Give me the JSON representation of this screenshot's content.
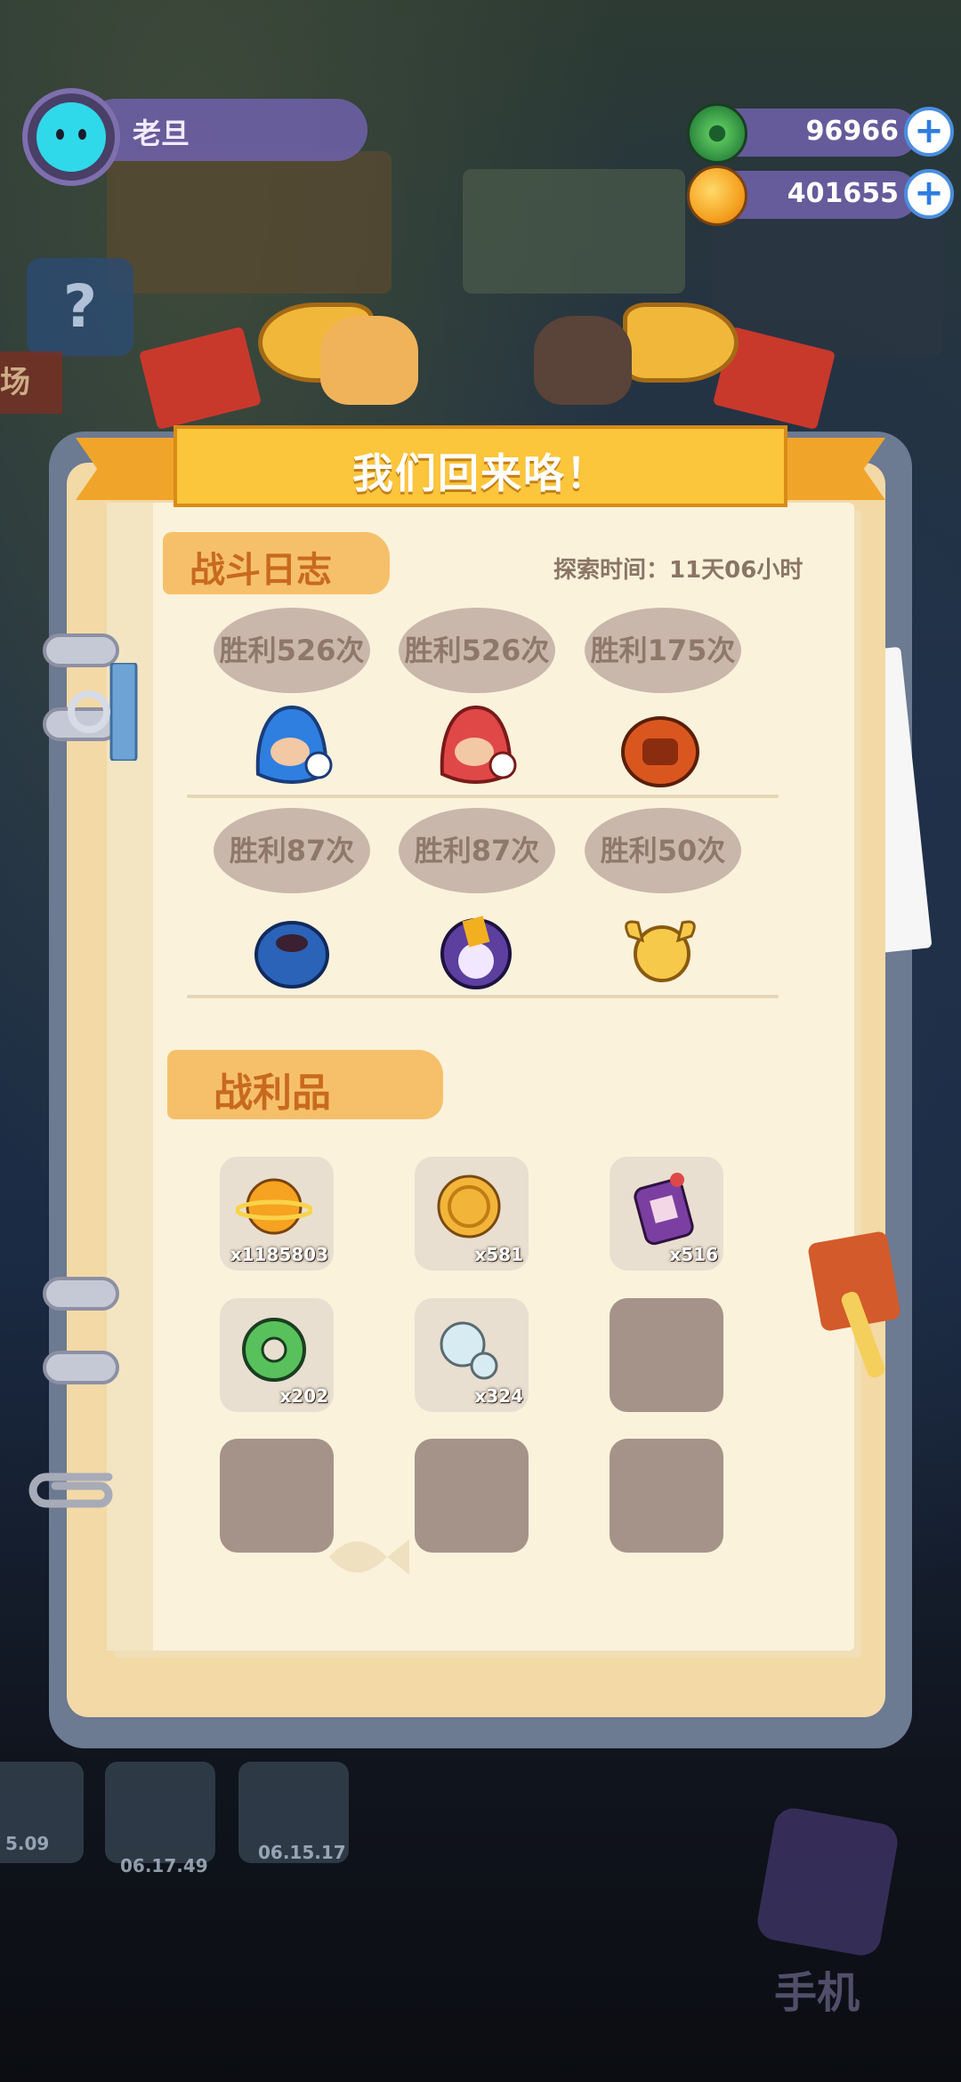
{
  "player": {
    "name": "老旦",
    "avatar_icon": "cyan-cat-avatar"
  },
  "currencies": [
    {
      "name": "green-gem",
      "value": "96966",
      "color": "#58c15b"
    },
    {
      "name": "gold-planet-coin",
      "value": "401655",
      "color": "#f5a321"
    }
  ],
  "background": {
    "timers": [
      "5.09",
      "06.17.49",
      "06.15.17"
    ],
    "help_icon": "?",
    "sign_text": "场",
    "phone_label": "手机"
  },
  "dialog": {
    "title": "我们回来咯！",
    "battle_log": {
      "heading": "战斗日志",
      "explore_time": "探索时间：11天06小时",
      "entries": [
        {
          "text": "胜利526次",
          "monster": "blue-star-hood-monster",
          "color": "#2f7fe0"
        },
        {
          "text": "胜利526次",
          "monster": "red-star-hood-monster",
          "color": "#e04848"
        },
        {
          "text": "胜利175次",
          "monster": "orange-furry-monster",
          "color": "#d9571f"
        },
        {
          "text": "胜利87次",
          "monster": "blue-horned-monster",
          "color": "#2b63b8"
        },
        {
          "text": "胜利87次",
          "monster": "purple-wizard-cat-monster",
          "color": "#5c3f9e"
        },
        {
          "text": "胜利50次",
          "monster": "yellow-winged-blob-monster",
          "color": "#f6c94b"
        }
      ]
    },
    "loot": {
      "heading": "战利品",
      "items": [
        {
          "icon": "orange-planet-coin-icon",
          "qty": "x1185803"
        },
        {
          "icon": "gold-cat-coin-icon",
          "qty": "x581"
        },
        {
          "icon": "purple-ticket-icon",
          "qty": "x516"
        },
        {
          "icon": "green-gem-icon",
          "qty": "x202"
        },
        {
          "icon": "bubble-orb-icon",
          "qty": "x324"
        },
        {
          "icon": "",
          "qty": ""
        },
        {
          "icon": "",
          "qty": ""
        },
        {
          "icon": "",
          "qty": ""
        },
        {
          "icon": "",
          "qty": ""
        }
      ]
    }
  }
}
